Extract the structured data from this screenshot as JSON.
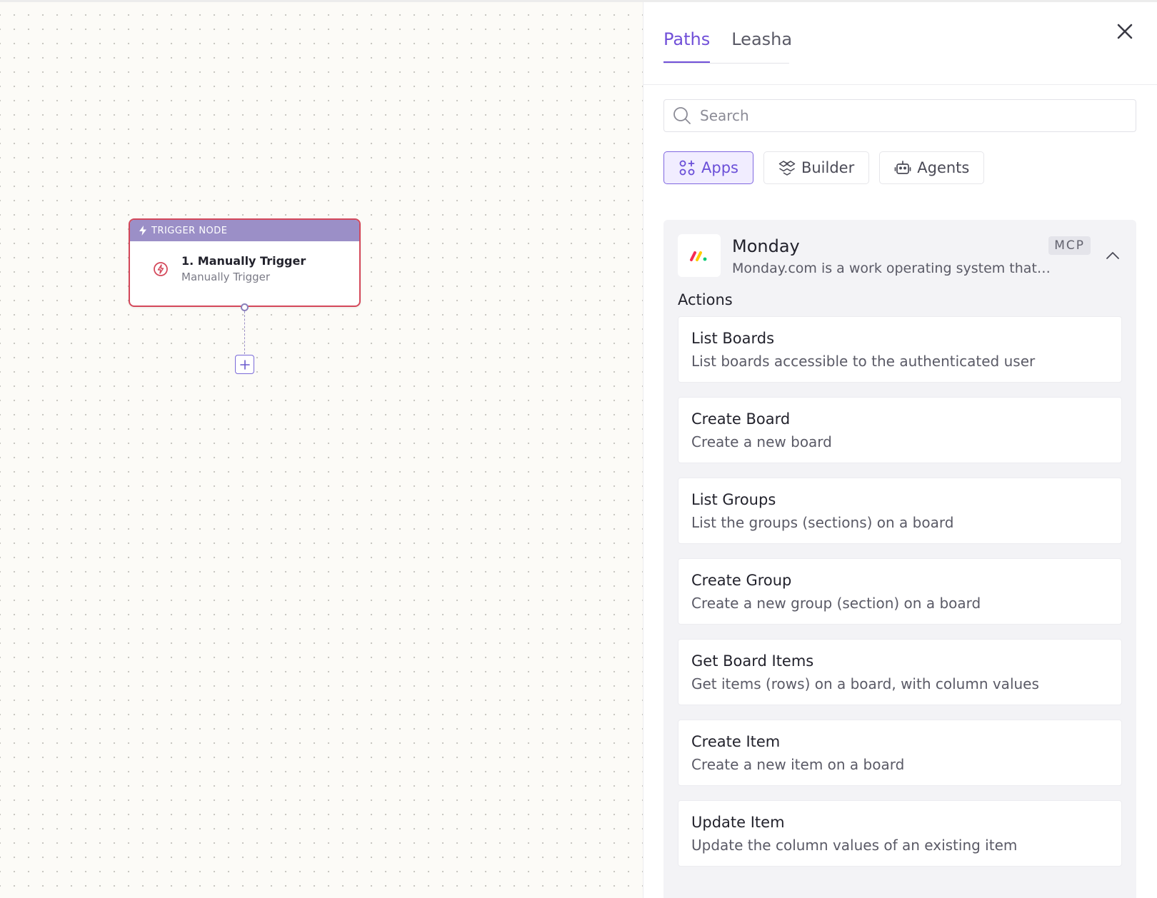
{
  "canvas": {
    "node": {
      "header": "TRIGGER NODE",
      "title": "1. Manually Trigger",
      "subtitle": "Manually Trigger"
    },
    "add_icon": "plus-icon"
  },
  "panel": {
    "tabs": [
      {
        "label": "Paths",
        "active": true
      },
      {
        "label": "Leasha",
        "active": false
      }
    ],
    "search": {
      "placeholder": "Search",
      "value": ""
    },
    "filters": [
      {
        "label": "Apps",
        "icon": "apps-icon",
        "active": true
      },
      {
        "label": "Builder",
        "icon": "builder-icon",
        "active": false
      },
      {
        "label": "Agents",
        "icon": "robot-icon",
        "active": false
      }
    ],
    "app": {
      "name": "Monday",
      "description": "Monday.com is a work operating system that…",
      "badge": "MCP",
      "actions_label": "Actions",
      "actions": [
        {
          "title": "List Boards",
          "description": "List boards accessible to the authenticated user"
        },
        {
          "title": "Create Board",
          "description": "Create a new board"
        },
        {
          "title": "List Groups",
          "description": "List the groups (sections) on a board"
        },
        {
          "title": "Create Group",
          "description": "Create a new group (section) on a board"
        },
        {
          "title": "Get Board Items",
          "description": "Get items (rows) on a board, with column values"
        },
        {
          "title": "Create Item",
          "description": "Create a new item on a board"
        },
        {
          "title": "Update Item",
          "description": "Update the column values of an existing item"
        }
      ]
    }
  },
  "colors": {
    "accent": "#7150d8",
    "node_border": "#d4485a",
    "node_header": "#9b8fc7"
  }
}
